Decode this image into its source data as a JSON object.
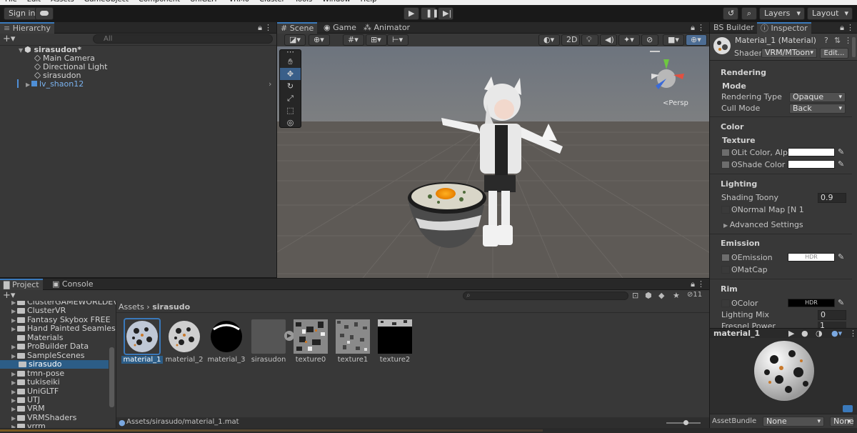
{
  "menu": [
    "File",
    "Edit",
    "Assets",
    "GameObject",
    "Component",
    "UniGLTF",
    "VRM0",
    "Cluster",
    "Tools",
    "Window",
    "Help"
  ],
  "toolbar": {
    "sign_in": "Sign in",
    "layers": "Layers",
    "layout": "Layout"
  },
  "hierarchy": {
    "tab": "Hierarchy",
    "search_placeholder": "All",
    "scene": "sirasudon*",
    "items": [
      "Main Camera",
      "Directional Light",
      "sirasudon",
      "lv_shaon12"
    ]
  },
  "scene_tabs": {
    "scene": "Scene",
    "game": "Game",
    "animator": "Animator",
    "two_d": "2D",
    "persp": "<Persp"
  },
  "project": {
    "tab": "Project",
    "console": "Console",
    "folders": [
      "ClusterGAMEWORLDEV",
      "ClusterVR",
      "Fantasy Skybox FREE",
      "Hand Painted Seamless",
      "Materials",
      "ProBuilder Data",
      "SampleScenes",
      "sirasudo",
      "tmn-pose",
      "tukiseiki",
      "UniGLTF",
      "UTJ",
      "VRM",
      "VRMShaders",
      "vrrm"
    ],
    "breadcrumb_root": "Assets",
    "breadcrumb_current": "sirasudo",
    "assets": [
      "material_1",
      "material_2",
      "material_3",
      "sirasudon",
      "texture0",
      "texture1",
      "texture2"
    ],
    "path": "Assets/sirasudo/material_1.mat",
    "count": "11"
  },
  "inspector": {
    "tab_bs": "BS Builder",
    "tab": "Inspector",
    "title": "Material_1 (Material)",
    "shader_label": "Shader",
    "shader": "VRM/MToon",
    "edit": "Edit...",
    "rendering": "Rendering",
    "mode": "Mode",
    "rendering_type_label": "Rendering Type",
    "rendering_type": "Opaque",
    "cull_label": "Cull Mode",
    "cull": "Back",
    "color": "Color",
    "texture": "Texture",
    "lit": "Lit Color, Alpha",
    "shade": "Shade Color",
    "lighting": "Lighting",
    "shading_toony": "Shading Toony",
    "shading_toony_val": "0.9",
    "normal": "Normal Map [N 1",
    "advanced": "Advanced Settings",
    "emission": "Emission",
    "emission_item": "Emission",
    "hdr": "HDR",
    "matcap": "MatCap",
    "rim": "Rim",
    "rim_color": "Color",
    "lighting_mix": "Lighting Mix",
    "lighting_mix_val": "0",
    "fresnel": "Fresnel Power",
    "fresnel_val": "1",
    "preview": "material_1",
    "assetbundle": "AssetBundle",
    "none": "None",
    "none2": "None"
  }
}
